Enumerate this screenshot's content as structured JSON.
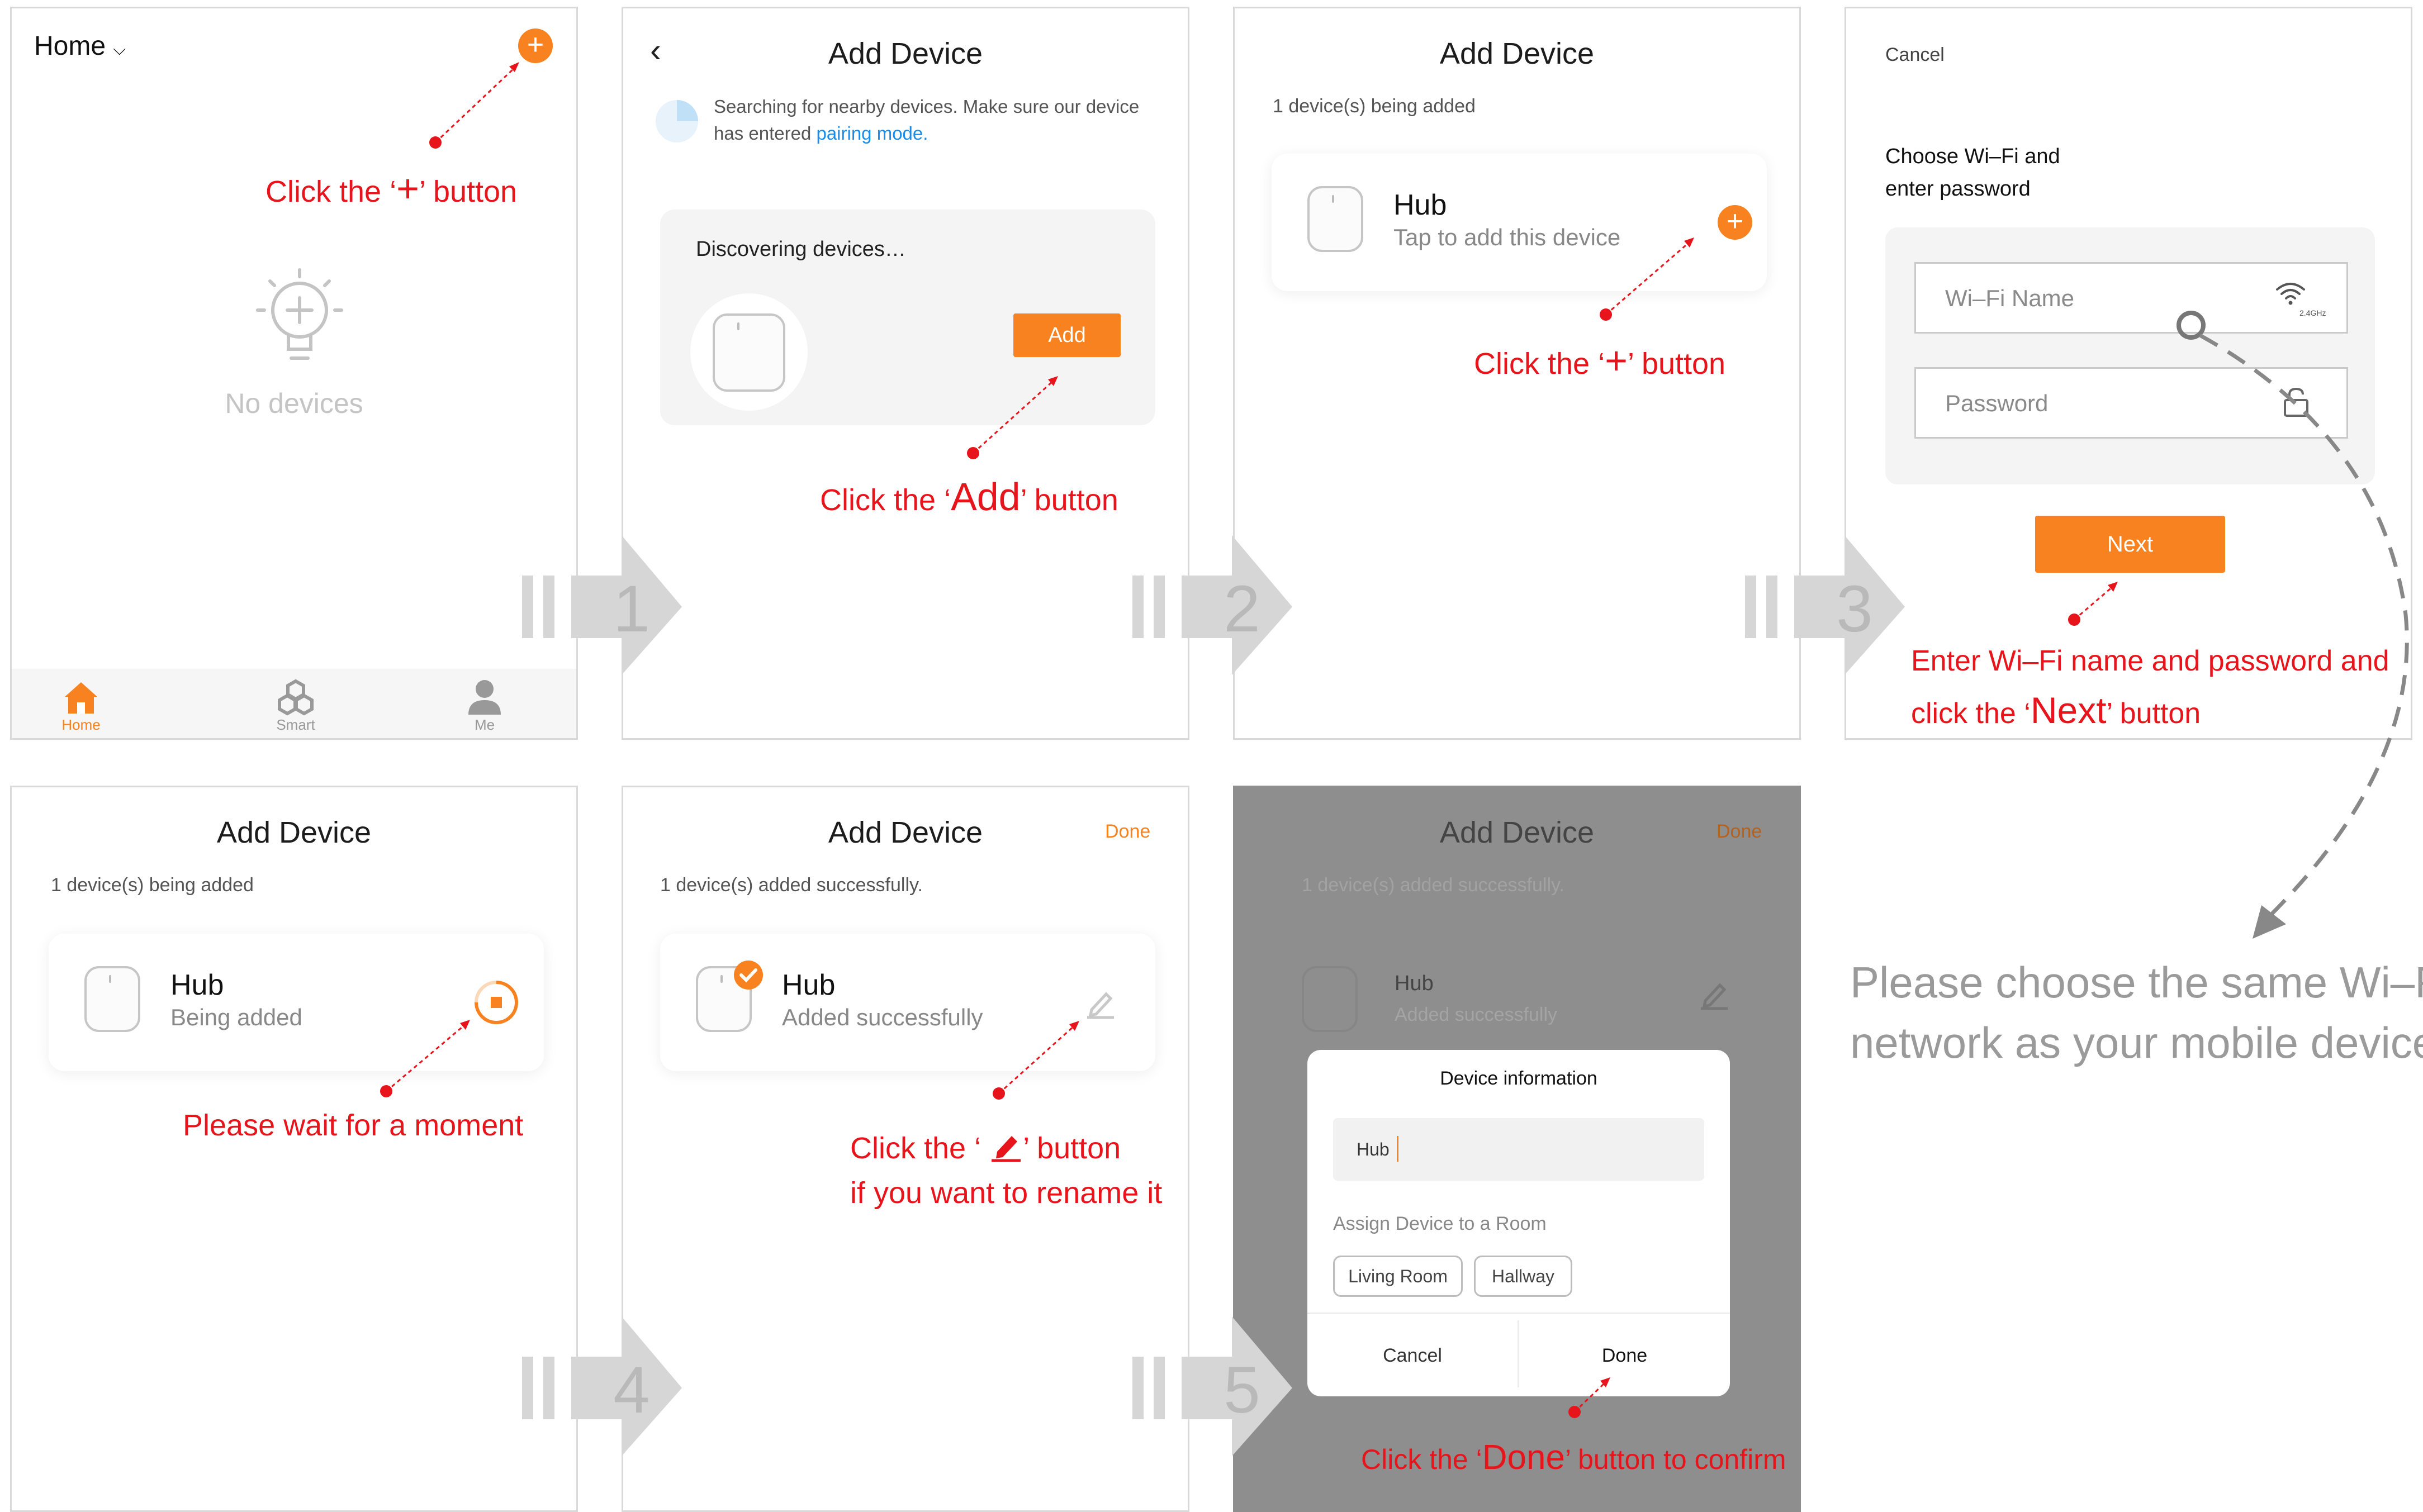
{
  "colors": {
    "accent": "#f7821f",
    "annotation": "#e8141b",
    "blue_link": "#1a8ce8",
    "overlay": "#8e8e8e"
  },
  "step_numbers": [
    "1",
    "2",
    "3",
    "4",
    "5"
  ],
  "screen1": {
    "header": "Home",
    "empty_label": "No devices",
    "nav": [
      {
        "label": "Home",
        "icon": "home-icon"
      },
      {
        "label": "Smart",
        "icon": "smart-icon"
      },
      {
        "label": "Me",
        "icon": "user-icon"
      }
    ],
    "annotation": {
      "pre": "Click the ‘",
      "key": "+",
      "post": "’ button"
    }
  },
  "screen2": {
    "title": "Add Device",
    "search_text_1": "Searching for nearby devices. Make sure our device",
    "search_text_2": "has entered ",
    "pairing_link": "pairing mode.",
    "discovering": "Discovering devices…",
    "add_button": "Add",
    "annotation": {
      "pre": "Click the ‘",
      "key": "Add",
      "post": "’ button"
    }
  },
  "screen3": {
    "title": "Add Device",
    "status": "1 device(s) being added",
    "device_name": "Hub",
    "device_sub": "Tap to add this device",
    "annotation": {
      "pre": "Click the ‘",
      "key": "+",
      "post": "’ button"
    }
  },
  "screen4": {
    "cancel": "Cancel",
    "heading_1": "Choose Wi–Fi and",
    "heading_2": "enter password",
    "wifi_placeholder": "Wi–Fi Name",
    "wifi_band": "2.4GHz",
    "password_placeholder": "Password",
    "next_button": "Next",
    "annotation_line1": "Enter Wi–Fi name and password and",
    "annotation_line2": {
      "pre": "click the ‘",
      "key": "Next",
      "post": "’ button"
    }
  },
  "note": {
    "line1": "Please choose the same Wi–Fi",
    "line2": "network as your mobile device."
  },
  "screen5": {
    "title": "Add Device",
    "status": "1 device(s) being added",
    "device_name": "Hub",
    "device_sub": "Being added",
    "annotation": "Please wait for a moment"
  },
  "screen6": {
    "title": "Add Device",
    "done": "Done",
    "status": "1 device(s) added successfully.",
    "device_name": "Hub",
    "device_sub": "Added successfully",
    "annotation_line1": {
      "pre": "Click the ‘",
      "post": "’ button"
    },
    "annotation_line2": "if you want to rename it"
  },
  "screen7": {
    "title": "Add Device",
    "done": "Done",
    "status": "1 device(s) added successfully.",
    "device_name": "Hub",
    "device_sub": "Added successfully",
    "dialog": {
      "title": "Device information",
      "name_value": "Hub",
      "room_label": "Assign Device to a Room",
      "rooms": [
        "Living Room",
        "Hallway"
      ],
      "cancel": "Cancel",
      "done": "Done"
    },
    "annotation": {
      "pre": "Click the ‘",
      "key": "Done",
      "post": "’ button to confirm"
    }
  }
}
